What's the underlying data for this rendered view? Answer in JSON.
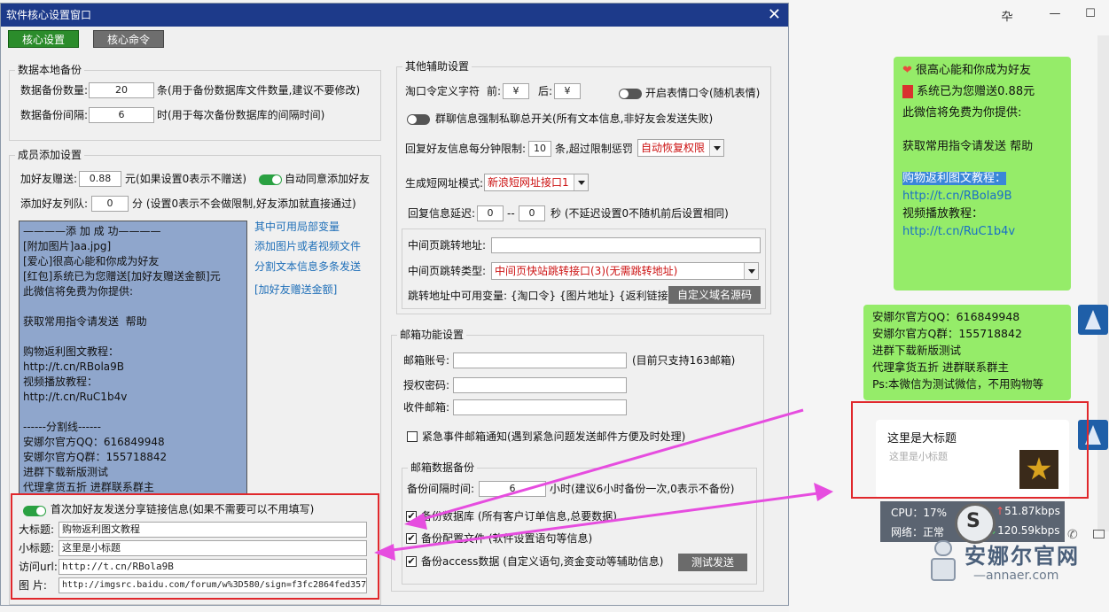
{
  "chat": {
    "win_min": "—",
    "win_max": "☐",
    "win_pin": "卆",
    "win_close": "✕",
    "bubble1": {
      "line1": "很高心能和你成为好友",
      "line2": "系统已为您赠送0.88元",
      "line3": "此微信将免费为你提供:",
      "line4": "获取常用指令请发送  帮助",
      "line5": "购物返利图文教程：",
      "line6": "http://t.cn/RBola9B",
      "line7": "视频播放教程：",
      "line8": "http://t.cn/RuC1b4v"
    },
    "bubble2": {
      "line1": "安娜尔官方QQ：616849948",
      "line2": "安娜尔官方Q群：155718842",
      "line3": "进群下载新版测试",
      "line4": "代理拿货五折 进群联系群主",
      "line5": "Ps:本微信为测试微信，不用购物等"
    },
    "card": {
      "title": "这里是大标题",
      "subtitle": "这里是小标题"
    },
    "net": {
      "cpu_label": "CPU：17%",
      "net_label": "网络：正常",
      "up": "51.87kbps",
      "down": "120.59kbps"
    },
    "watermark_site": "安娜尔官网",
    "watermark_url": "—annaer.com"
  },
  "dialog": {
    "title": "软件核心设置窗口",
    "close": "✕",
    "tab_core_settings": "核心设置",
    "tab_core_commands": "核心命令",
    "backup": {
      "legend": "数据本地备份",
      "count_label": "数据备份数量:",
      "count_value": "20",
      "count_note": "条(用于备份数据库文件数量,建议不要修改)",
      "interval_label": "数据备份间隔:",
      "interval_value": "6",
      "interval_note": "时(用于每次备份数据库的间隔时间)"
    },
    "member": {
      "legend": "成员添加设置",
      "gift_label": "加好友赠送:",
      "gift_value": "0.88",
      "gift_note": "元(如果设置0表示不赠送)",
      "auto_agree": "自动同意添加好友",
      "queue_label": "添加好友列队:",
      "queue_value": "0",
      "queue_note": "分 (设置0表示不会做限制,好友添加就直接通过)",
      "msg_lines": [
        "————添 加 成 功————",
        "[附加图片]aa.jpg]",
        "[爱心]很高心能和你成为好友",
        "[红包]系统已为您赠送[加好友赠送金额]元",
        "此微信将免费为你提供:",
        "",
        "获取常用指令请发送  帮助",
        "",
        "购物返利图文教程：",
        "http://t.cn/RBola9B",
        "视频播放教程：",
        "http://t.cn/RuC1b4v",
        "",
        "------分割线------",
        "安娜尔官方QQ：616849948",
        "安娜尔官方Q群：155718842",
        "进群下载新版测试",
        "代理拿货五折 进群联系群主"
      ],
      "side_links": {
        "vars": "其中可用局部变量",
        "add_media": "添加图片或者视频文件",
        "split": "分割文本信息多条发送",
        "gift_var": "[加好友赠送金额]"
      },
      "share_toggle": "首次加好友发送分享链接信息(如果不需要可以不用填写)",
      "big_title_label": "大标题:",
      "big_title_value": "购物返利图文教程",
      "small_title_label": "小标题:",
      "small_title_value": "这里是小标题",
      "url_label": "访问url:",
      "url_value": "http://t.cn/RBola9B",
      "img_label": "图    片:",
      "img_value": "http://imgsrc.baidu.com/forum/w%3D580/sign=f3fc2864fed3572"
    },
    "other": {
      "legend": "其他辅助设置",
      "tao_label": "淘口令定义字符",
      "front_label": "前:",
      "front_value": "¥",
      "back_label": "后:",
      "back_value": "¥",
      "emoji_toggle": "开启表情口令(随机表情)",
      "group_toggle": "群聊信息强制私聊总开关(所有文本信息,非好友会发送失败)",
      "reply_limit_label": "回复好友信息每分钟限制:",
      "reply_limit_value": "10",
      "reply_limit_note": "条,超过限制惩罚",
      "penalty_value": "自动恢复权限",
      "short_url_label": "生成短网址模式:",
      "short_url_value": "新浪短网址接口1",
      "delay_label": "回复信息延迟:",
      "delay_from": "0",
      "delay_sep": "--",
      "delay_to": "0",
      "delay_note": "秒 (不延迟设置0不随机前后设置相同)",
      "jump_addr_label": "中间页跳转地址:",
      "jump_addr_value": "",
      "jump_type_label": "中间页跳转类型:",
      "jump_type_value": "中间页快站跳转接口(3)(无需跳转地址)",
      "jump_vars": "跳转地址中可用变量: {淘口令} {图片地址} {返利链接}",
      "custom_domain_btn": "自定义域名源码"
    },
    "mail": {
      "legend": "邮箱功能设置",
      "account_label": "邮箱账号:",
      "account_value": "",
      "account_note": "(目前只支持163邮箱)",
      "auth_label": "授权密码:",
      "auth_value": "",
      "recv_label": "收件邮箱:",
      "recv_value": "",
      "urgent_label": "紧急事件邮箱通知(遇到紧急问题发送邮件方便及时处理)",
      "backup_legend": "邮箱数据备份",
      "bk_interval_label": "备份间隔时间:",
      "bk_interval_value": "6",
      "bk_interval_note": "小时(建议6小时备份一次,0表示不备份)",
      "bk_db": "备份数据库  (所有客户订单信息,总要数据)",
      "bk_cfg": "备份配置文件  (软件设置语句等信息)",
      "bk_access": "备份access数据  (自定义语句,资金变动等辅助信息)",
      "test_send_btn": "测试发送"
    }
  }
}
